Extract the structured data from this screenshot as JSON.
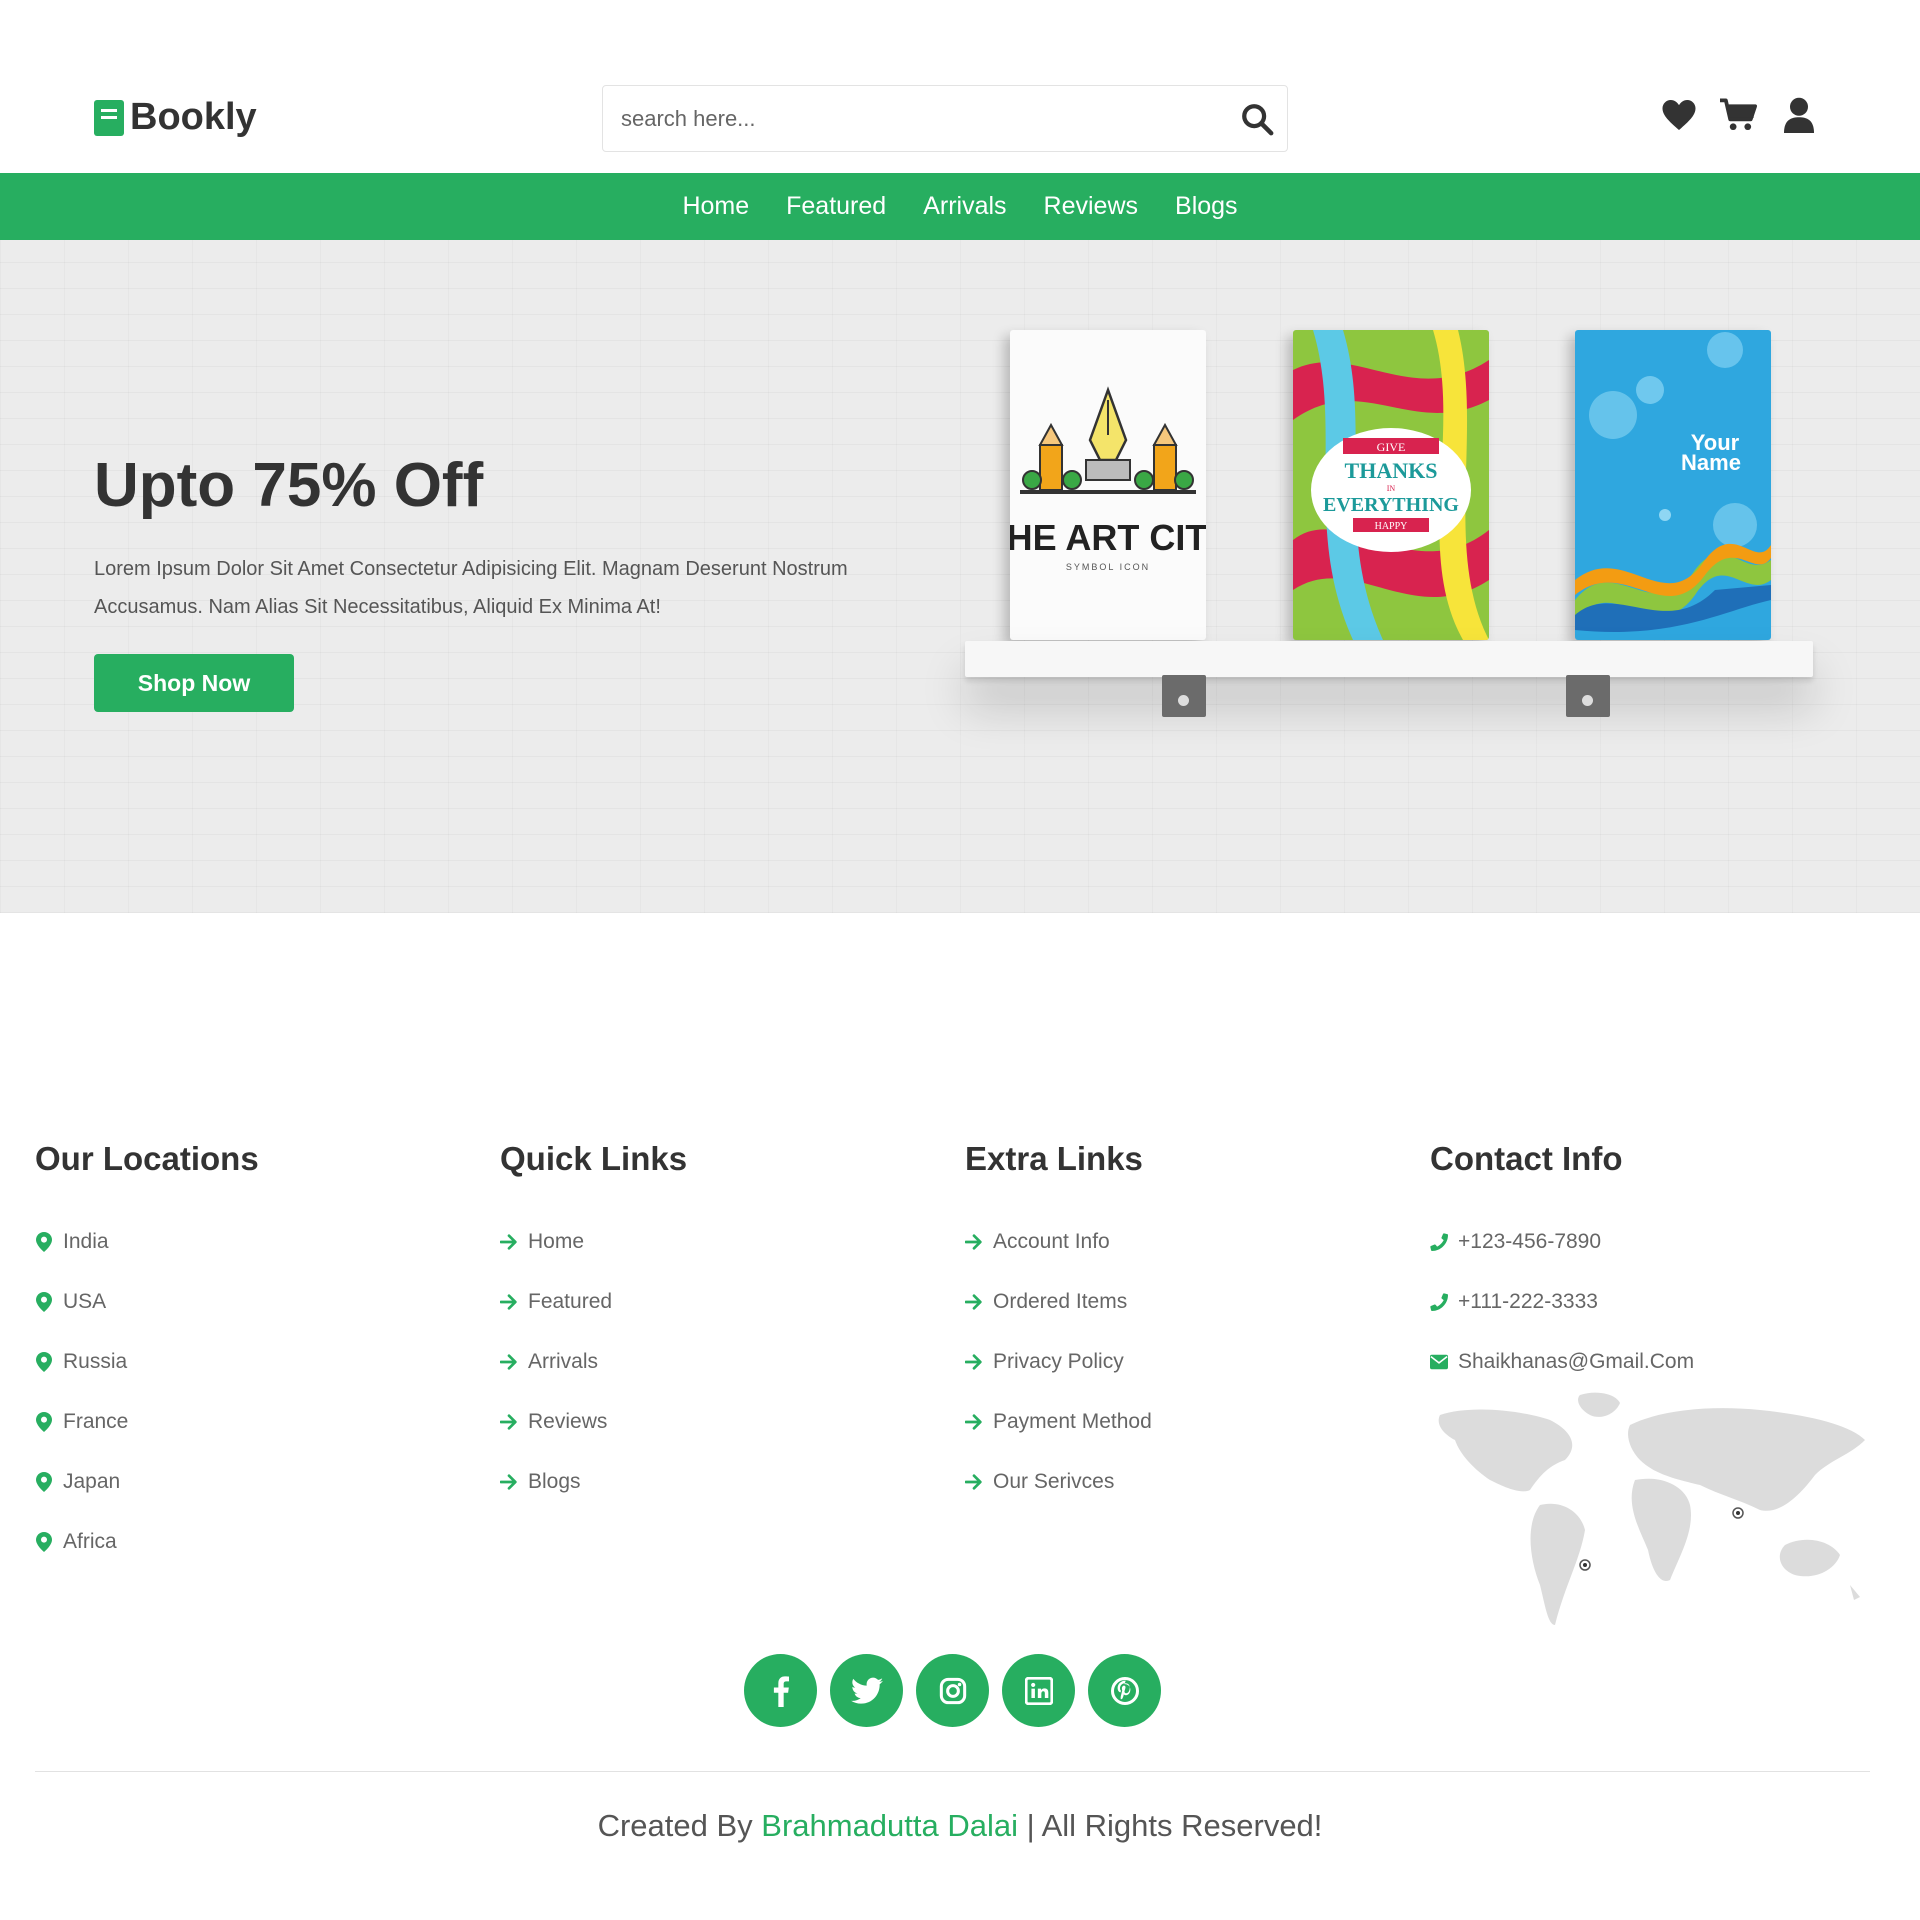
{
  "brand": {
    "name": "Bookly",
    "accent": "#27ae60"
  },
  "search": {
    "placeholder": "search here..."
  },
  "header_icons": [
    "heart-icon",
    "cart-icon",
    "user-icon"
  ],
  "nav": {
    "items": [
      "Home",
      "Featured",
      "Arrivals",
      "Reviews",
      "Blogs"
    ]
  },
  "hero": {
    "title": "Upto 75% Off",
    "description": "Lorem Ipsum Dolor Sit Amet Consectetur Adipisicing Elit. Magnam Deserunt Nostrum Accusamus. Nam Alias Sit Necessitatibus, Aliquid Ex Minima At!",
    "button_label": "Shop Now",
    "books": [
      {
        "title": "THE ART CITY",
        "subtitle": "SYMBOL ICON"
      },
      {
        "line1": "GIVE",
        "line2": "THANKS",
        "line3": "IN",
        "line4": "EVERYTHING",
        "line5": "HAPPY"
      },
      {
        "line1": "Your",
        "line2": "Name"
      }
    ]
  },
  "footer": {
    "locations": {
      "title": "Our Locations",
      "items": [
        "India",
        "USA",
        "Russia",
        "France",
        "Japan",
        "Africa"
      ]
    },
    "quick_links": {
      "title": "Quick Links",
      "items": [
        "Home",
        "Featured",
        "Arrivals",
        "Reviews",
        "Blogs"
      ]
    },
    "extra_links": {
      "title": "Extra Links",
      "items": [
        "Account Info",
        "Ordered Items",
        "Privacy Policy",
        "Payment Method",
        "Our Serivces"
      ]
    },
    "contact": {
      "title": "Contact Info",
      "phone1": "+123-456-7890",
      "phone2": "+111-222-3333",
      "email": "Shaikhanas@Gmail.Com"
    },
    "social": [
      "facebook-icon",
      "twitter-icon",
      "instagram-icon",
      "linkedin-icon",
      "pinterest-icon"
    ],
    "credit": {
      "prefix": "Created By ",
      "author": "Brahmadutta Dalai",
      "suffix": " | All Rights Reserved!"
    }
  }
}
